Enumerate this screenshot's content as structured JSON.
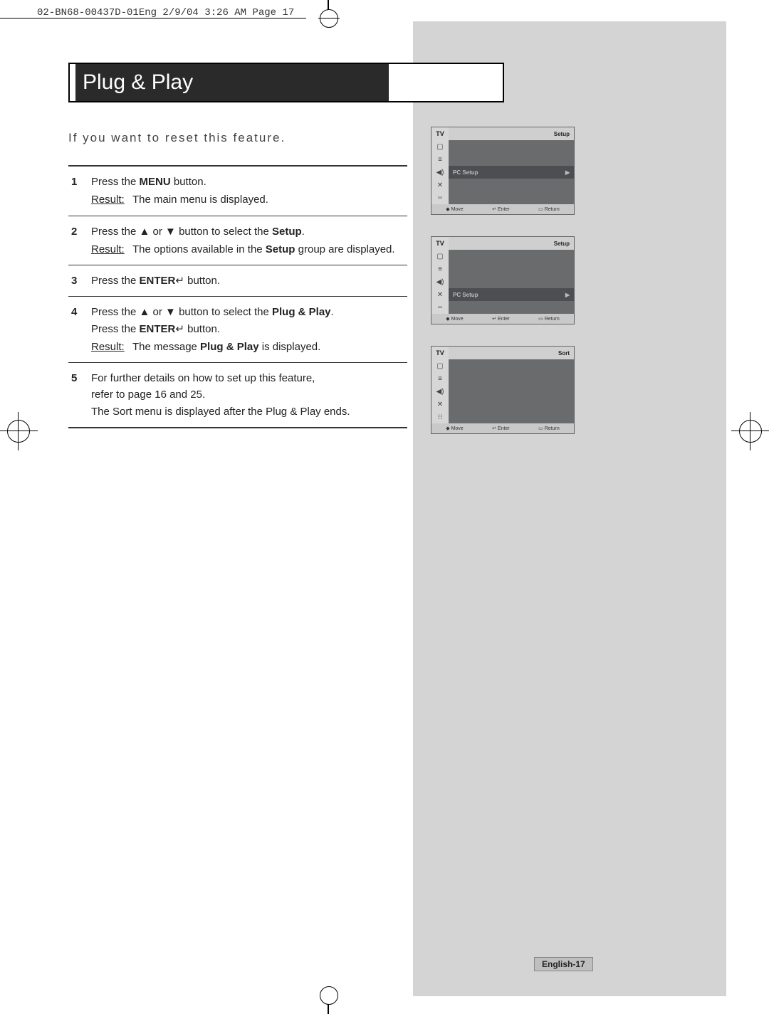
{
  "print_header": "02-BN68-00437D-01Eng  2/9/04 3:26 AM  Page 17",
  "title": "Plug & Play",
  "intro": "If you want to reset this feature.",
  "result_label": "Result:",
  "steps": [
    {
      "num": "1",
      "line1_a": "Press the ",
      "line1_b": "MENU",
      "line1_c": " button.",
      "result": "The main menu is displayed."
    },
    {
      "num": "2",
      "line1_a": "Press the ",
      "arrows": "▲ or ▼",
      "line1_b": " button to select the ",
      "line1_bold": "Setup",
      "line1_c": ".",
      "result_a": "The options available in the ",
      "result_bold": "Setup",
      "result_b": " group are displayed."
    },
    {
      "num": "3",
      "line1_a": "Press the ",
      "line1_b": "ENTER",
      "enter_glyph": "↵",
      "line1_c": " button."
    },
    {
      "num": "4",
      "line1_a": "Press the ",
      "arrows": "▲ or ▼",
      "line1_b": " button to select the ",
      "line1_bold": "Plug & Play",
      "line1_c": ".",
      "line2_a": "Press the ",
      "line2_b": "ENTER",
      "enter_glyph": "↵",
      "line2_c": " button.",
      "result_a": "The message ",
      "result_bold": "Plug & Play",
      "result_b": " is displayed."
    },
    {
      "num": "5",
      "line1": "For further details on how to set up this feature,",
      "line2": "refer to page 16 and 25.",
      "line3": "The Sort menu is displayed after the Plug & Play ends."
    }
  ],
  "osd": {
    "tv": "TV",
    "setup": "Setup",
    "sort": "Sort",
    "pc_setup": "PC Setup",
    "move": "Move",
    "enter": "Enter",
    "return": "Return",
    "arrow": "▸",
    "updown": "◆",
    "enter_glyph": "↵",
    "menu_glyph": "▭"
  },
  "page_badge": "English-17"
}
